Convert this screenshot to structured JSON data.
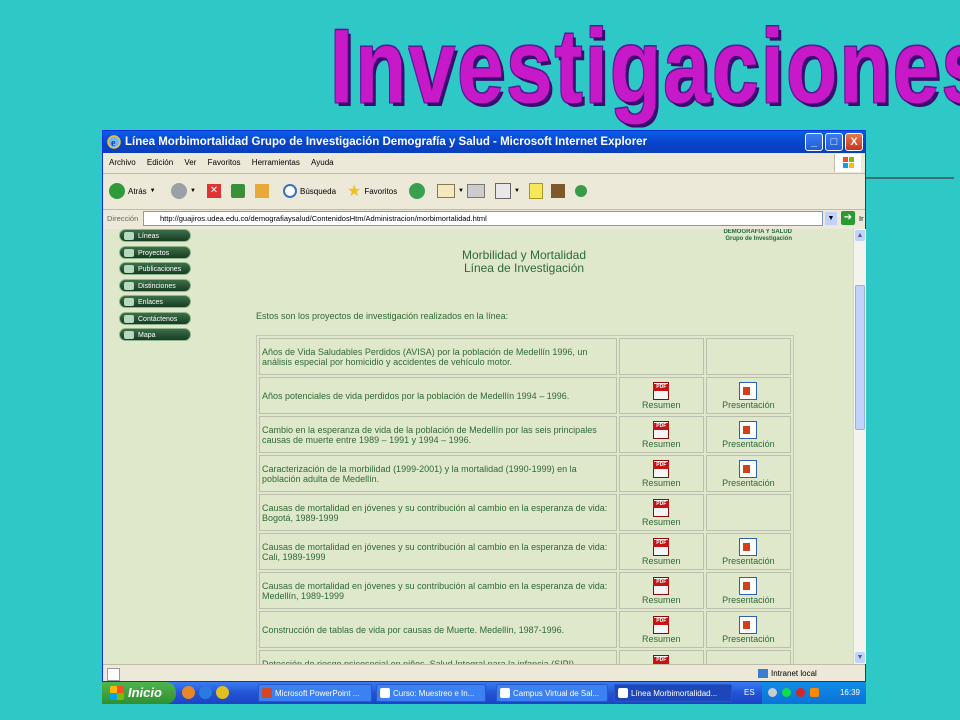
{
  "slide": {
    "title": "Investigaciones"
  },
  "window": {
    "title": "Línea Morbimortalidad Grupo de Investigación Demografía y Salud - Microsoft Internet Explorer",
    "min": "_",
    "max": "□",
    "close": "X"
  },
  "menu": [
    "Archivo",
    "Edición",
    "Ver",
    "Favoritos",
    "Herramientas",
    "Ayuda"
  ],
  "toolbar": {
    "back": "Atrás",
    "search": "Búsqueda",
    "favorites": "Favoritos"
  },
  "address": {
    "label": "Dirección",
    "url": "http://guajiros.udea.edu.co/demografiaysalud/ContenidosHtm/Administracion/morbimortalidad.html",
    "go": "Ir"
  },
  "sidenav": [
    "Líneas",
    "Proyectos",
    "Publicaciones",
    "Distinciones",
    "Enlaces",
    "Contáctenos",
    "Mapa"
  ],
  "logo": {
    "line1": "DEMOGRAFIA Y SALUD",
    "line2": "Grupo de Investigación"
  },
  "page": {
    "heading": "Morbilidad y Mortalidad",
    "subheading": "Línea de Investigación",
    "intro": "Estos son los proyectos de investigación realizados en la línea:"
  },
  "labels": {
    "resumen": "Resumen",
    "presentacion": "Presentación"
  },
  "projects": [
    {
      "text": "Años de Vida Saludables Perdidos (AVISA) por la población de Medellín 1996, un análisis especial por homicidio y accidentes de vehículo motor.",
      "resumen": false,
      "presentacion": false
    },
    {
      "text": "Años potenciales de vida perdidos por la población de Medellín 1994 – 1996.",
      "resumen": true,
      "presentacion": true
    },
    {
      "text": "Cambio en la esperanza de vida de la población de Medellín por las seis principales causas de muerte entre 1989 – 1991 y 1994 – 1996.",
      "resumen": true,
      "presentacion": true
    },
    {
      "text": "Caracterización de la morbilidad (1999-2001) y la mortalidad (1990-1999) en la población adulta de Medellín.",
      "resumen": true,
      "presentacion": true
    },
    {
      "text": "Causas de mortalidad en jóvenes y su contribución al cambio en la esperanza de vida: Bogotá, 1989-1999",
      "resumen": true,
      "presentacion": false
    },
    {
      "text": "Causas de mortalidad en jóvenes y su contribución al cambio en la esperanza de vida: Cali, 1989-1999",
      "resumen": true,
      "presentacion": true
    },
    {
      "text": "Causas de mortalidad en jóvenes y su contribución al cambio en la esperanza de vida: Medellín, 1989-1999",
      "resumen": true,
      "presentacion": true
    },
    {
      "text": "Construcción de tablas de vida por causas de Muerte. Medellín, 1987-1996.",
      "resumen": true,
      "presentacion": true
    },
    {
      "text": "Detección de riesgo psicosocial en niños. Salud Integral para la infancia (SIPI). Pediatría Social. Universidad de Antioquia. Medellín, 2000-2002.",
      "resumen": true,
      "presentacion": false
    }
  ],
  "status": {
    "zone": "Intranet local"
  },
  "taskbar": {
    "start": "Inicio",
    "tasks": [
      "Microsoft PowerPoint ...",
      "Curso: Muestreo e In...",
      "Campus Virtual de Sal...",
      "Línea Morbimortalidad..."
    ],
    "lang": "ES",
    "clock": "16:39"
  }
}
